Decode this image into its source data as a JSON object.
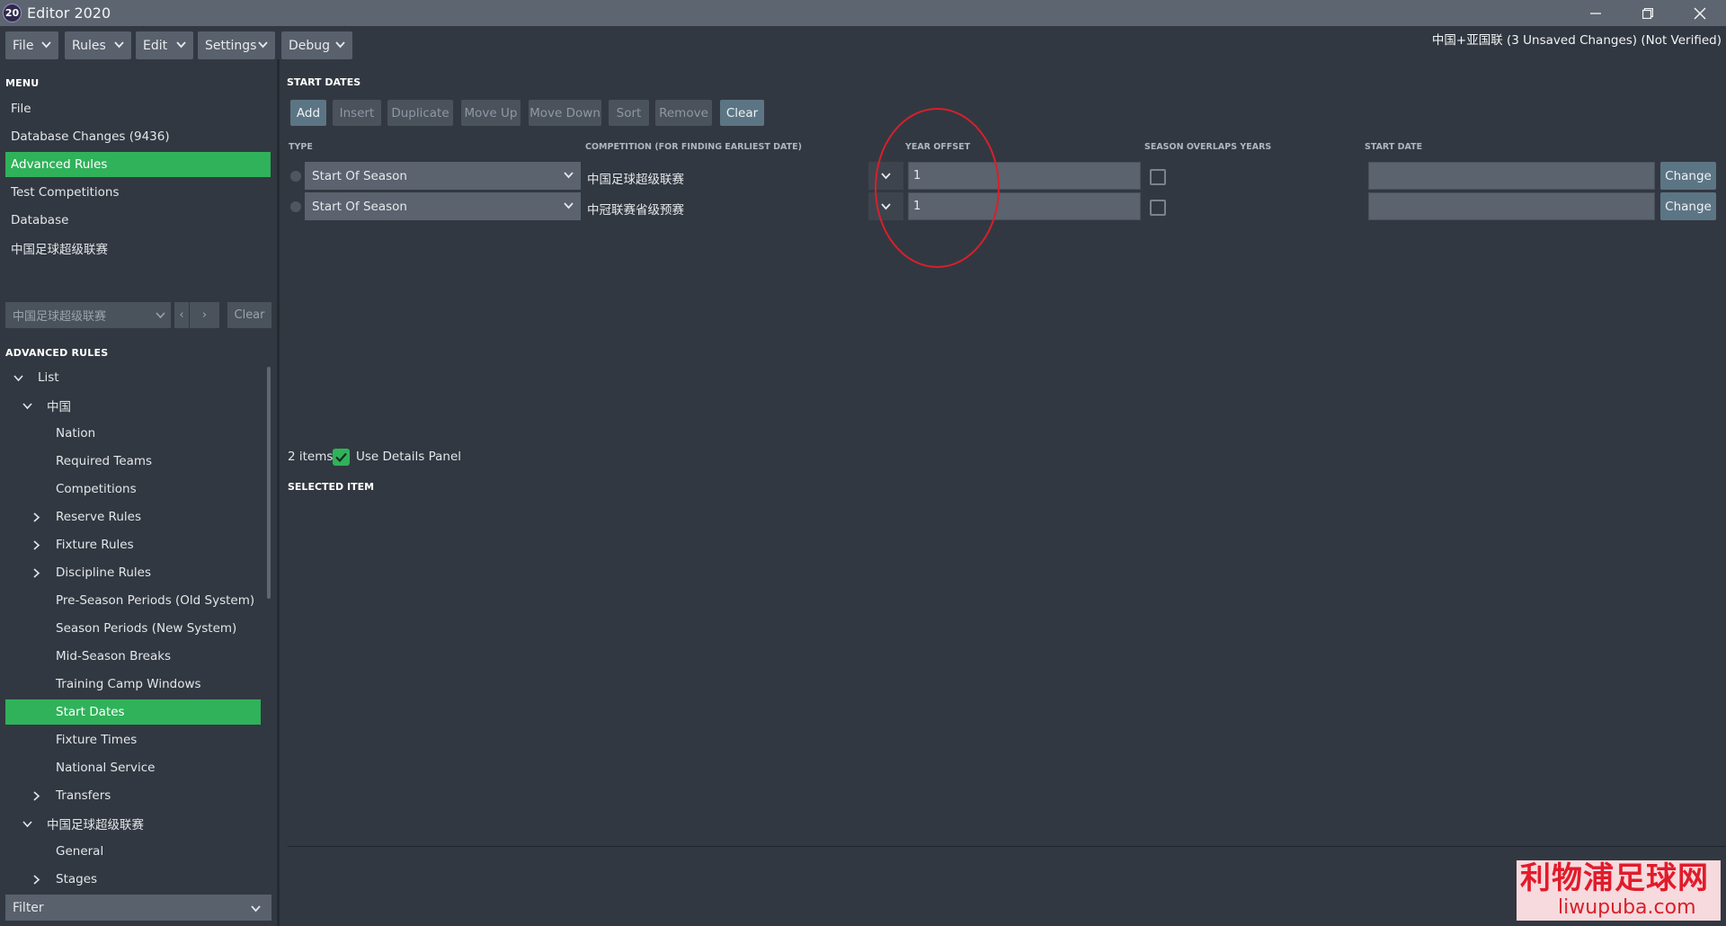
{
  "window": {
    "app_icon_text": "20",
    "title": "Editor 2020",
    "project_status": "中国+亚国联 (3 Unsaved Changes) (Not Verified)"
  },
  "menubar": [
    "File",
    "Rules",
    "Edit",
    "Settings",
    "Debug"
  ],
  "sidebar": {
    "menu_heading": "MENU",
    "menu_items": [
      "File",
      "Database Changes (9436)",
      "Advanced Rules",
      "Test Competitions",
      "Database",
      "中国足球超级联赛"
    ],
    "active_menu_item": "Advanced Rules",
    "competition_combo_value": "中国足球超级联赛",
    "prev_glyph": "‹",
    "next_glyph": "›",
    "clear_label": "Clear",
    "advanced_rules_heading": "ADVANCED RULES",
    "tree": [
      {
        "label": "List",
        "level": 0,
        "toggle": "expanded"
      },
      {
        "label": "中国",
        "level": 1,
        "toggle": "expanded"
      },
      {
        "label": "Nation",
        "level": 2,
        "toggle": "none"
      },
      {
        "label": "Required Teams",
        "level": 2,
        "toggle": "none"
      },
      {
        "label": "Competitions",
        "level": 2,
        "toggle": "none"
      },
      {
        "label": "Reserve Rules",
        "level": 2,
        "toggle": "collapsed"
      },
      {
        "label": "Fixture Rules",
        "level": 2,
        "toggle": "collapsed"
      },
      {
        "label": "Discipline Rules",
        "level": 2,
        "toggle": "collapsed"
      },
      {
        "label": "Pre-Season Periods (Old System)",
        "level": 2,
        "toggle": "none"
      },
      {
        "label": "Season Periods (New System)",
        "level": 2,
        "toggle": "none"
      },
      {
        "label": "Mid-Season Breaks",
        "level": 2,
        "toggle": "none"
      },
      {
        "label": "Training Camp Windows",
        "level": 2,
        "toggle": "none"
      },
      {
        "label": "Start Dates",
        "level": 2,
        "toggle": "none",
        "active": true
      },
      {
        "label": "Fixture Times",
        "level": 2,
        "toggle": "none"
      },
      {
        "label": "National Service",
        "level": 2,
        "toggle": "none"
      },
      {
        "label": "Transfers",
        "level": 2,
        "toggle": "collapsed"
      },
      {
        "label": "中国足球超级联赛",
        "level": 1,
        "toggle": "expanded"
      },
      {
        "label": "General",
        "level": 2,
        "toggle": "none"
      },
      {
        "label": "Stages",
        "level": 2,
        "toggle": "collapsed"
      }
    ],
    "filter_label": "Filter"
  },
  "main": {
    "heading": "START DATES",
    "toolbar": [
      {
        "label": "Add",
        "enabled": true
      },
      {
        "label": "Insert",
        "enabled": false
      },
      {
        "label": "Duplicate",
        "enabled": false
      },
      {
        "label": "Move Up",
        "enabled": false
      },
      {
        "label": "Move Down",
        "enabled": false
      },
      {
        "label": "Sort",
        "enabled": false
      },
      {
        "label": "Remove",
        "enabled": false
      },
      {
        "label": "Clear",
        "enabled": true
      }
    ],
    "columns": [
      "TYPE",
      "COMPETITION (FOR FINDING EARLIEST DATE)",
      "YEAR OFFSET",
      "SEASON OVERLAPS YEARS",
      "START DATE"
    ],
    "rows": [
      {
        "type": "Start Of Season",
        "competition": "中国足球超级联赛",
        "year_offset": "1",
        "season_overlaps": false,
        "start_date": "",
        "change_label": "Change"
      },
      {
        "type": "Start Of Season",
        "competition": "中冠联赛省级预赛",
        "year_offset": "1",
        "season_overlaps": false,
        "start_date": "",
        "change_label": "Change"
      }
    ],
    "items_count": "2 items",
    "use_details_panel_label": "Use Details Panel",
    "use_details_panel_checked": true,
    "selected_item_heading": "SELECTED ITEM"
  },
  "watermark": {
    "text_cn": "利物浦足球网",
    "url": "liwupuba.com"
  },
  "colors": {
    "accent_green": "#2fb25a",
    "background": "#323841",
    "annotation_red": "#d8202c"
  }
}
